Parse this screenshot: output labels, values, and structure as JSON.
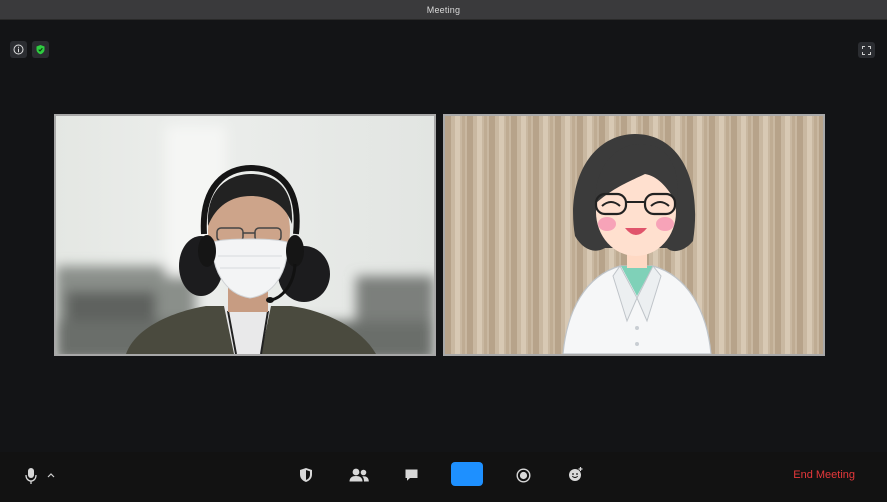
{
  "window": {
    "title": "Meeting"
  },
  "top_left_icons": [
    {
      "name": "info-icon"
    },
    {
      "name": "encryption-shield-icon",
      "color": "#2ecc40"
    }
  ],
  "top_right_icon": {
    "name": "fullscreen-icon"
  },
  "participants": [
    {
      "tile": "participant-video-man",
      "content": "man wearing headset and face mask"
    },
    {
      "tile": "participant-video-cartoon-doctor",
      "content": "cartoon woman doctor in lab coat"
    }
  ],
  "toolbar": {
    "mic": {
      "icon": "microphone-icon"
    },
    "mic_options": {
      "icon": "caret-up-icon"
    },
    "security": {
      "icon": "security-shield-icon"
    },
    "participants": {
      "icon": "participants-icon"
    },
    "chat": {
      "icon": "chat-icon"
    },
    "share_screen": {
      "icon": "share-screen-icon",
      "color": "#1e90ff"
    },
    "record": {
      "icon": "record-icon"
    },
    "reactions": {
      "icon": "reactions-icon"
    },
    "end_meeting_label": "End Meeting",
    "end_meeting_color": "#e5383b"
  }
}
